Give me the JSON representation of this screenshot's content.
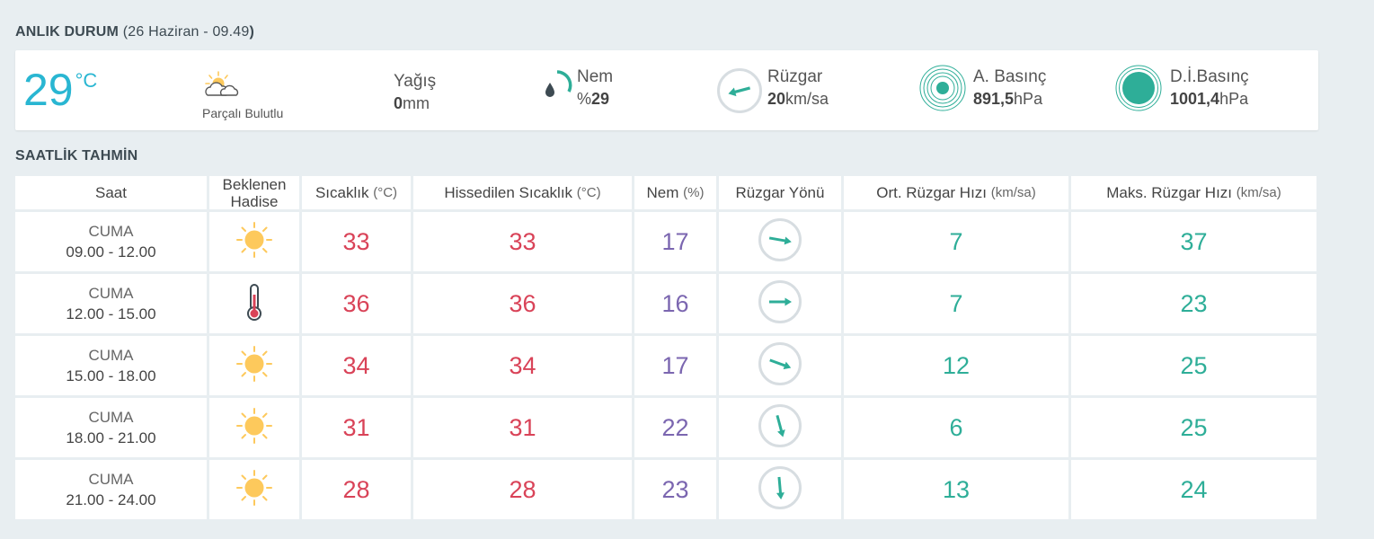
{
  "current": {
    "title": "ANLIK DURUM",
    "date_open": "(",
    "date": "26 Haziran - 09.49",
    "date_close": ")",
    "temperature": "29",
    "temp_unit": "°C",
    "condition": "Parçalı Bulutlu",
    "condition_icon": "partly-cloudy-icon",
    "precip": {
      "label": "Yağış",
      "value": "0",
      "unit": "mm"
    },
    "humidity": {
      "label": "Nem",
      "prefix": "%",
      "value": "29",
      "icon": "humidity-drop-icon"
    },
    "wind": {
      "label": "Rüzgar",
      "value": "20",
      "unit": "km/sa",
      "icon": "wind-direction-icon"
    },
    "pressure": {
      "label": "A. Basınç",
      "value": "891,5",
      "unit": "hPa",
      "icon": "pressure-icon"
    },
    "sea_pressure": {
      "label": "D.İ.Basınç",
      "value": "1001,4",
      "unit": "hPa",
      "icon": "sea-pressure-icon"
    }
  },
  "hourly": {
    "title": "SAATLİK TAHMİN",
    "headers": {
      "saat": "Saat",
      "hadise_1": "Beklenen",
      "hadise_2": "Hadise",
      "sicaklik": "Sıcaklık",
      "sicaklik_unit": "(°C)",
      "hissedilen": "Hissedilen Sıcaklık",
      "hissedilen_unit": "(°C)",
      "nem": "Nem",
      "nem_unit": "(%)",
      "yon": "Rüzgar Yönü",
      "ort": "Ort. Rüzgar Hızı",
      "ort_unit": "(km/sa)",
      "mak": "Maks. Rüzgar Hızı",
      "mak_unit": "(km/sa)"
    },
    "rows": [
      {
        "day": "CUMA",
        "time": "09.00 - 12.00",
        "icon": "sun-icon",
        "temp": "33",
        "feels": "33",
        "humidity": "17",
        "wind_dir_deg": 100,
        "wind_avg": "7",
        "wind_max": "37"
      },
      {
        "day": "CUMA",
        "time": "12.00 - 15.00",
        "icon": "thermometer-icon",
        "temp": "36",
        "feels": "36",
        "humidity": "16",
        "wind_dir_deg": 90,
        "wind_avg": "7",
        "wind_max": "23"
      },
      {
        "day": "CUMA",
        "time": "15.00 - 18.00",
        "icon": "sun-icon",
        "temp": "34",
        "feels": "34",
        "humidity": "17",
        "wind_dir_deg": 110,
        "wind_avg": "12",
        "wind_max": "25"
      },
      {
        "day": "CUMA",
        "time": "18.00 - 21.00",
        "icon": "sun-icon",
        "temp": "31",
        "feels": "31",
        "humidity": "22",
        "wind_dir_deg": 165,
        "wind_avg": "6",
        "wind_max": "25"
      },
      {
        "day": "CUMA",
        "time": "21.00 - 24.00",
        "icon": "sun-icon",
        "temp": "28",
        "feels": "28",
        "humidity": "23",
        "wind_dir_deg": 175,
        "wind_avg": "13",
        "wind_max": "24"
      }
    ]
  },
  "colors": {
    "temp": "#d94358",
    "humidity": "#7b66b0",
    "wind": "#2eae98",
    "current_temp": "#29b6d2",
    "sun": "#fdc95c"
  }
}
